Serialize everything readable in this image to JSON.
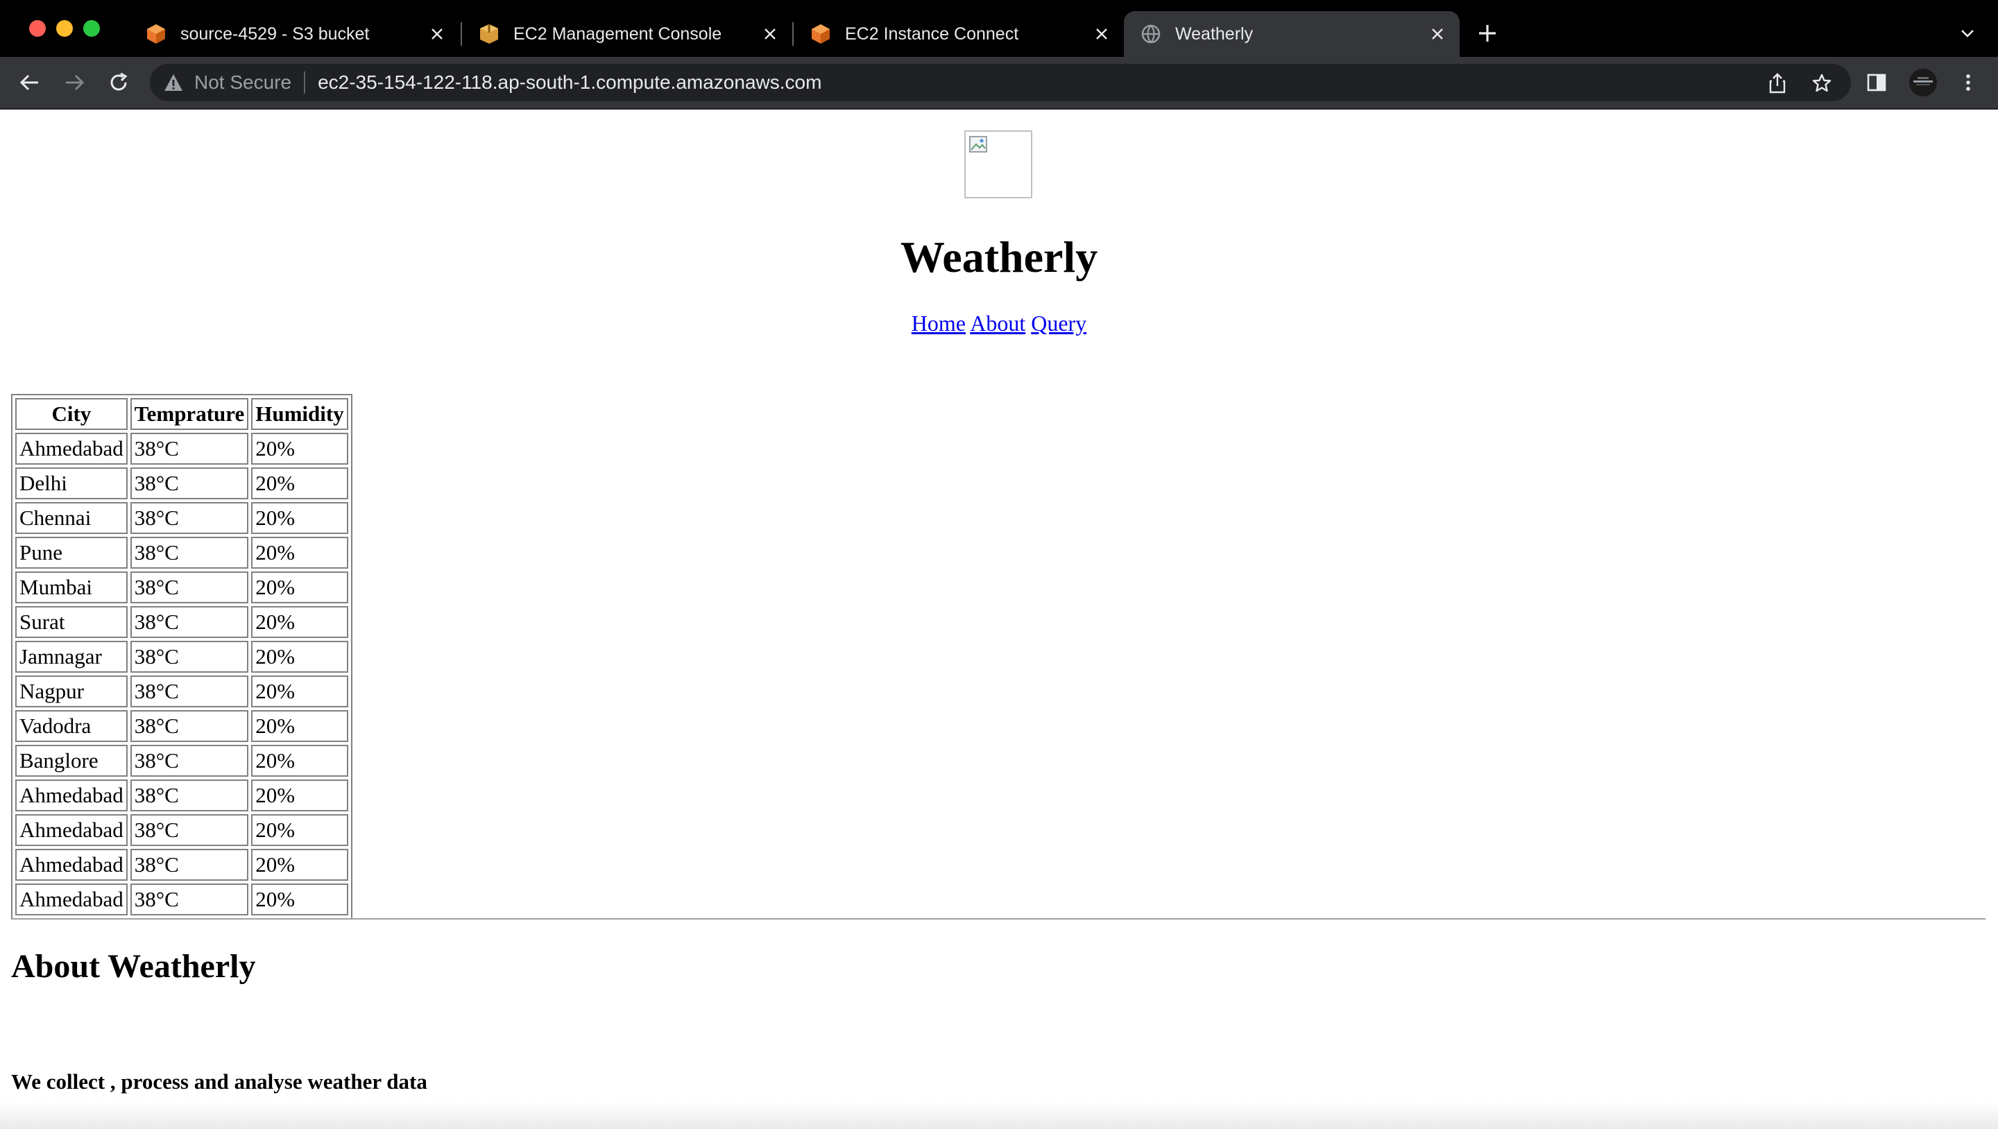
{
  "browser": {
    "tabs": [
      {
        "title": "source-4529 - S3 bucket",
        "icon": "aws-s3-icon",
        "active": false
      },
      {
        "title": "EC2 Management Console",
        "icon": "aws-box-icon",
        "active": false
      },
      {
        "title": "EC2 Instance Connect",
        "icon": "aws-box-icon",
        "active": false
      },
      {
        "title": "Weatherly",
        "icon": "globe-icon",
        "active": true
      }
    ],
    "security_label": "Not Secure",
    "url": "ec2-35-154-122-118.ap-south-1.compute.amazonaws.com"
  },
  "page": {
    "title": "Weatherly",
    "nav": {
      "home": "Home",
      "about": "About",
      "query": "Query"
    },
    "table": {
      "headers": [
        "City",
        "Temprature",
        "Humidity"
      ],
      "rows": [
        [
          "Ahmedabad",
          "38°C",
          "20%"
        ],
        [
          "Delhi",
          "38°C",
          "20%"
        ],
        [
          "Chennai",
          "38°C",
          "20%"
        ],
        [
          "Pune",
          "38°C",
          "20%"
        ],
        [
          "Mumbai",
          "38°C",
          "20%"
        ],
        [
          "Surat",
          "38°C",
          "20%"
        ],
        [
          "Jamnagar",
          "38°C",
          "20%"
        ],
        [
          "Nagpur",
          "38°C",
          "20%"
        ],
        [
          "Vadodra",
          "38°C",
          "20%"
        ],
        [
          "Banglore",
          "38°C",
          "20%"
        ],
        [
          "Ahmedabad",
          "38°C",
          "20%"
        ],
        [
          "Ahmedabad",
          "38°C",
          "20%"
        ],
        [
          "Ahmedabad",
          "38°C",
          "20%"
        ],
        [
          "Ahmedabad",
          "38°C",
          "20%"
        ]
      ]
    },
    "about": {
      "heading": "About Weatherly",
      "text": "We collect , process and analyse weather data"
    }
  },
  "colors": {
    "tabstrip": "#000000",
    "toolbar": "#35363a",
    "link": "#0000ee",
    "aws_orange": "#f58534"
  }
}
